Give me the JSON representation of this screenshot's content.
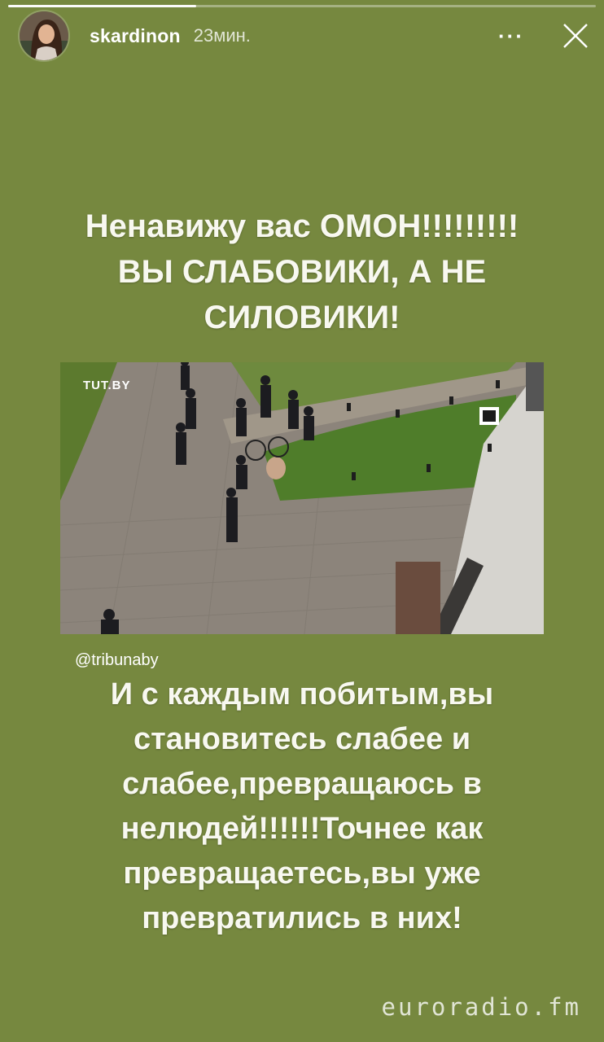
{
  "story": {
    "progress": 0.32,
    "username": "skardinon",
    "time_ago": "23мин.",
    "more_icon": "more-dots-icon",
    "close_icon": "close-icon"
  },
  "content": {
    "headline_line1": "Ненавижу вас ОМОН!!!!!!!!!",
    "headline_line2": "ВЫ СЛАБОВИКИ, А НЕ",
    "headline_line3": "СИЛОВИКИ!",
    "photo_logo": "TUT.BY",
    "photo_credit": "@tribunaby",
    "body_line1": "И с  каждым побитым,вы",
    "body_line2": "становитесь слабее и",
    "body_line3": "слабее,превращаюсь в",
    "body_line4": "нелюдей!!!!!!Точнее как",
    "body_line5": "превращаетесь,вы уже",
    "body_line6": "превратились в них!"
  },
  "watermark": "euroradio.fm",
  "colors": {
    "background": "#76883f",
    "text": "#f8f8f0"
  }
}
